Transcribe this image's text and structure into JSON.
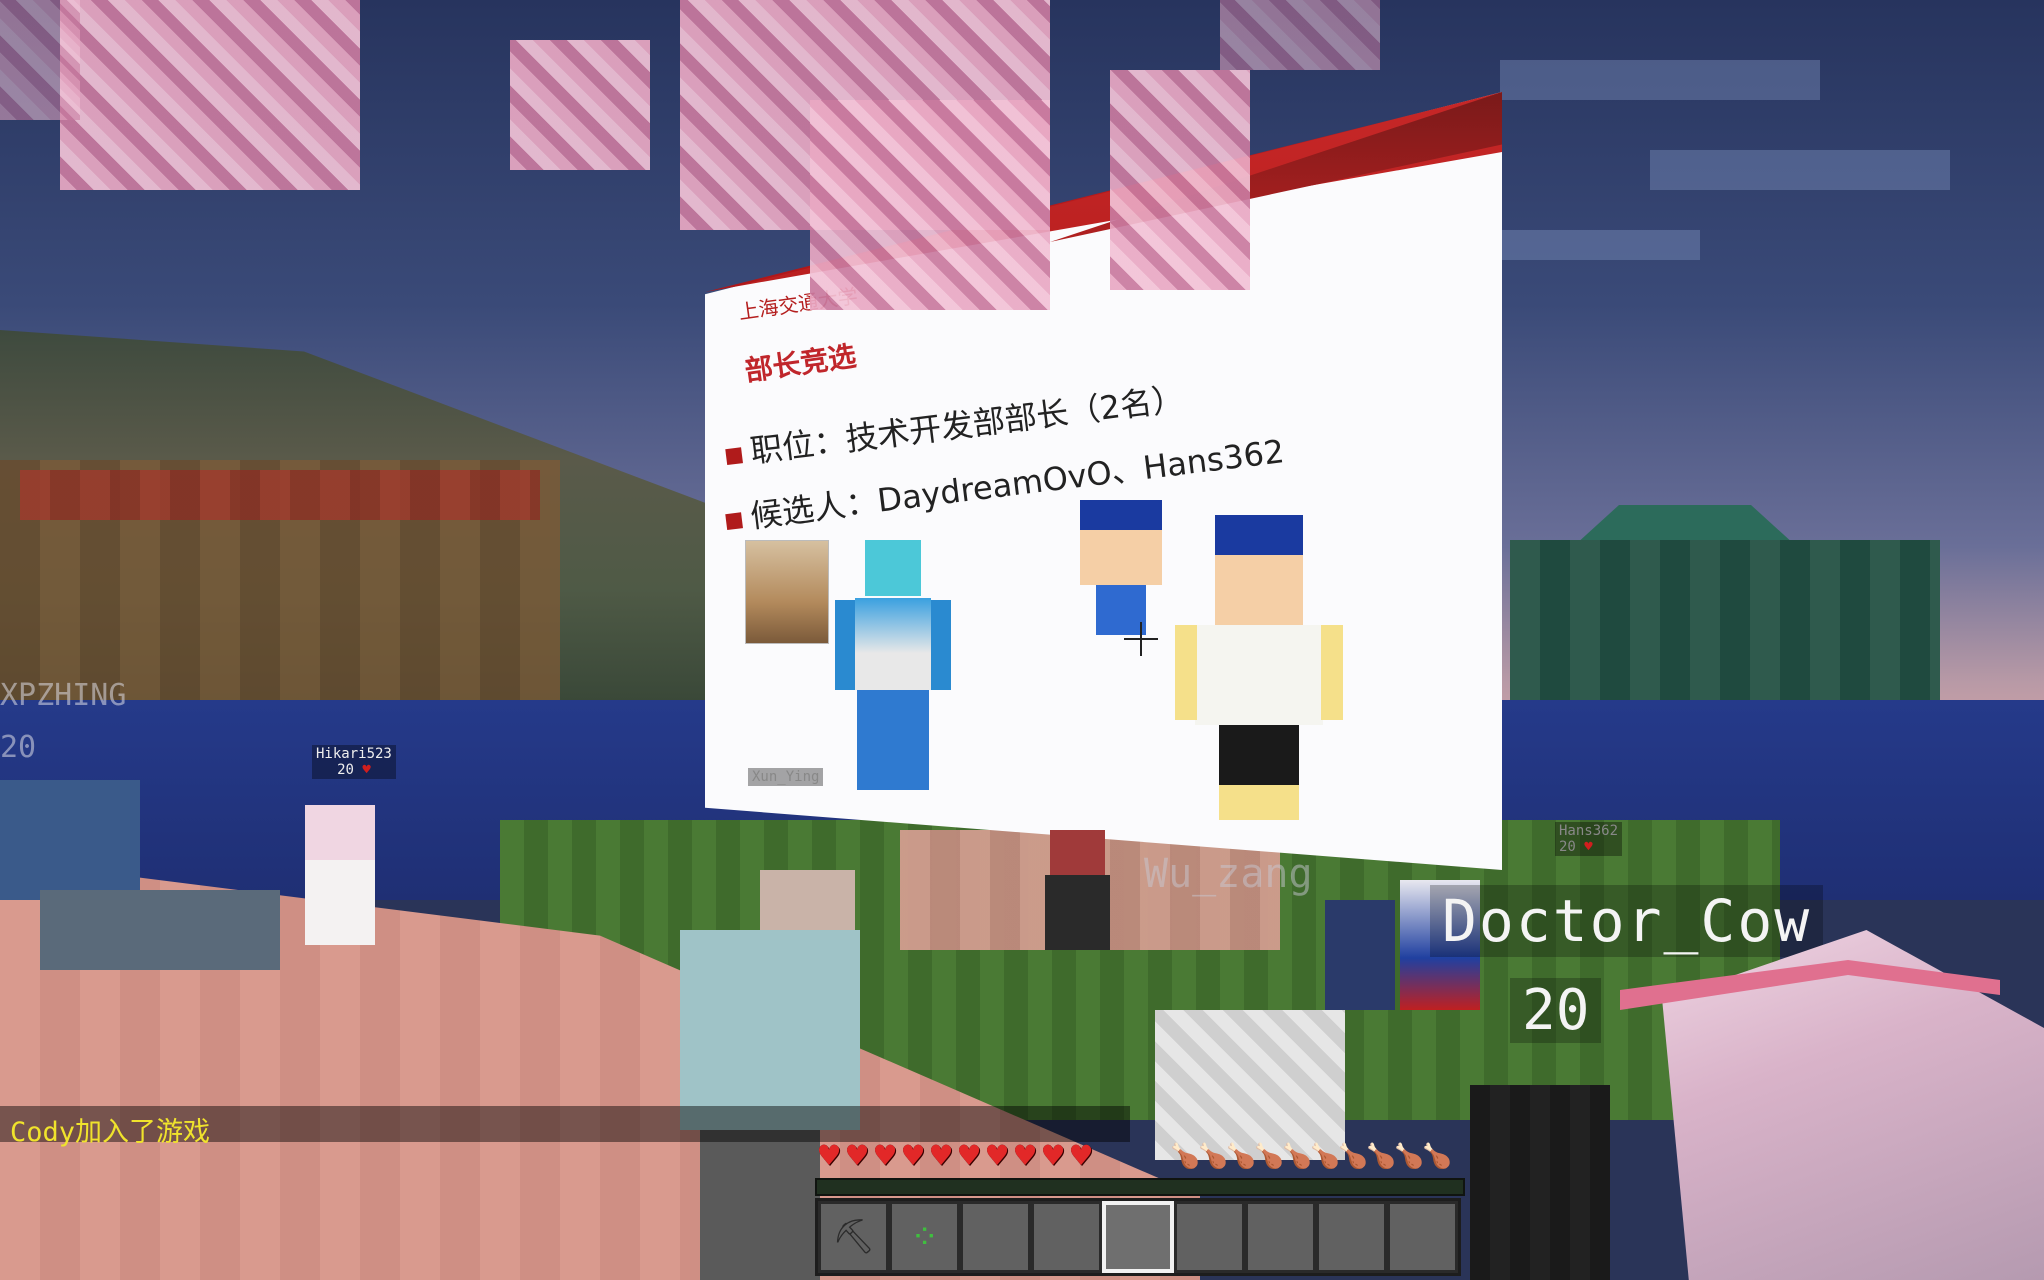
{
  "game": "Minecraft",
  "slide": {
    "logo_text": "上海交通大学",
    "title": "部长竞选",
    "position_line": "职位：技术开发部部长（2名）",
    "candidates_line": "候选人：DaydreamOvO、Hans362"
  },
  "nametags": [
    {
      "name": "Hikari523",
      "score": "20"
    },
    {
      "name": "Xun_Ying"
    },
    {
      "name": "Hans362",
      "score": "20"
    },
    {
      "name": "Wu_zang"
    }
  ],
  "ghost_tag": {
    "name": "XPZHING",
    "score": "20"
  },
  "focused_player": {
    "name": "Doctor_Cow",
    "score": "20"
  },
  "chat": {
    "message": "Cody加入了游戏"
  },
  "hud": {
    "health_hearts": 10,
    "hunger_drumsticks": 10,
    "xp_fraction": 0.0,
    "hotbar": [
      {
        "item": "pickaxe-icon"
      },
      {
        "item": "seeds-icon"
      },
      {
        "item": ""
      },
      {
        "item": ""
      },
      {
        "item": ""
      },
      {
        "item": ""
      },
      {
        "item": ""
      },
      {
        "item": ""
      },
      {
        "item": ""
      }
    ],
    "selected_slot": 4
  },
  "colors": {
    "slide_accent": "#c0262b",
    "heart": "#e22828",
    "chat_text": "#f0e32c",
    "sky_top": "#27345e",
    "water": "#253a8a"
  }
}
